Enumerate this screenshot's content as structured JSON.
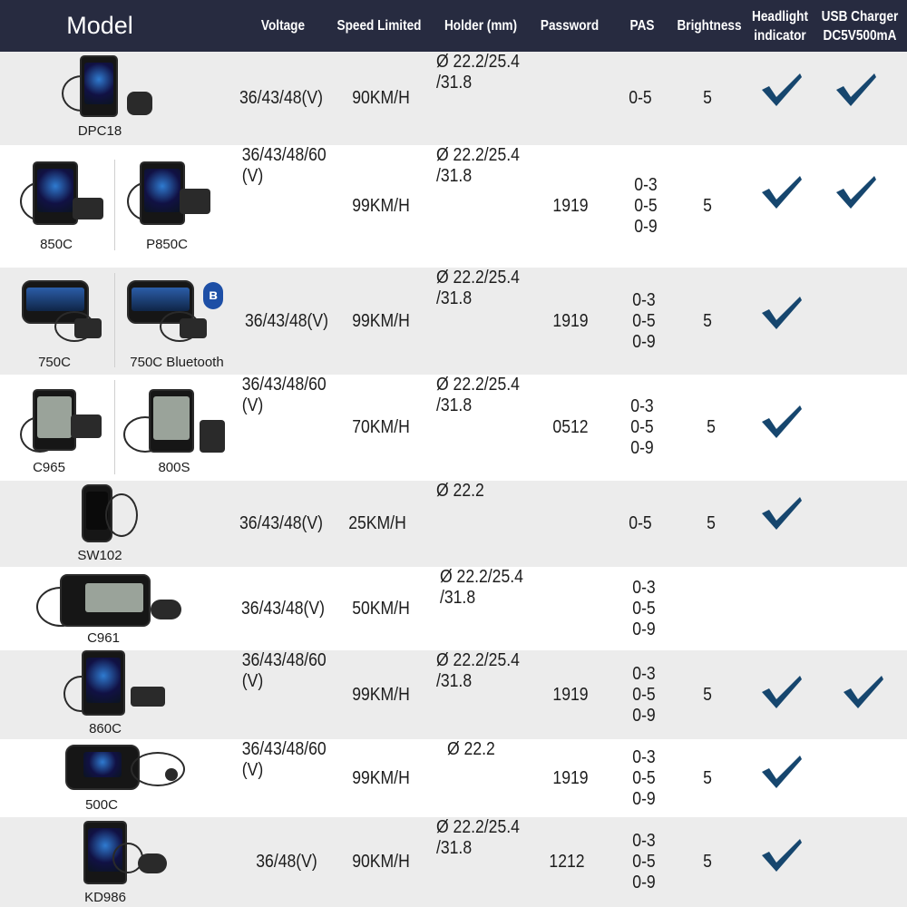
{
  "header": {
    "model": "Model",
    "voltage": "Voltage",
    "speed": "Speed Limited",
    "holder": "Holder (mm)",
    "password": "Password",
    "pas": "PAS",
    "brightness": "Brightness",
    "headlight_line1": "Headlight",
    "headlight_line2": "indicator",
    "usb_line1": "USB Charger",
    "usb_line2": "DC5V500mA"
  },
  "rows": [
    {
      "models": [
        "DPC18"
      ],
      "voltage": [
        "36/43/48(V)"
      ],
      "speed": "90KM/H",
      "holder": [
        "Ø 22.2/25.4",
        "/31.8"
      ],
      "password": "",
      "pas": [
        "0-5"
      ],
      "brightness": "5",
      "headlight": true,
      "usb": true
    },
    {
      "models": [
        "850C",
        "P850C"
      ],
      "voltage": [
        "36/43/48/60",
        "(V)"
      ],
      "speed": "99KM/H",
      "holder": [
        "Ø 22.2/25.4",
        "/31.8"
      ],
      "password": "1919",
      "pas": [
        "0-3",
        "0-5",
        "0-9"
      ],
      "brightness": "5",
      "headlight": true,
      "usb": true
    },
    {
      "models": [
        "750C",
        "750C Bluetooth"
      ],
      "voltage": [
        "36/43/48(V)"
      ],
      "speed": "99KM/H",
      "holder": [
        "Ø 22.2/25.4",
        "/31.8"
      ],
      "password": "1919",
      "pas": [
        "0-3",
        "0-5",
        "0-9"
      ],
      "brightness": "5",
      "headlight": true,
      "usb": false
    },
    {
      "models": [
        "C965",
        "800S"
      ],
      "voltage": [
        "36/43/48/60",
        "(V)"
      ],
      "speed": "70KM/H",
      "holder": [
        "Ø 22.2/25.4",
        "/31.8"
      ],
      "password": "0512",
      "pas": [
        "0-3",
        "0-5",
        "0-9"
      ],
      "brightness": "5",
      "headlight": true,
      "usb": false
    },
    {
      "models": [
        "SW102"
      ],
      "voltage": [
        "36/43/48(V)"
      ],
      "speed": "25KM/H",
      "holder": [
        "Ø 22.2"
      ],
      "password": "",
      "pas": [
        "0-5"
      ],
      "brightness": "5",
      "headlight": true,
      "usb": false
    },
    {
      "models": [
        "C961"
      ],
      "voltage": [
        "36/43/48(V)"
      ],
      "speed": "50KM/H",
      "holder": [
        "Ø 22.2/25.4",
        "/31.8"
      ],
      "password": "",
      "pas": [
        "0-3",
        "0-5",
        "0-9"
      ],
      "brightness": "",
      "headlight": false,
      "usb": false
    },
    {
      "models": [
        "860C"
      ],
      "voltage": [
        "36/43/48/60",
        "(V)"
      ],
      "speed": "99KM/H",
      "holder": [
        "Ø 22.2/25.4",
        "/31.8"
      ],
      "password": "1919",
      "pas": [
        "0-3",
        "0-5",
        "0-9"
      ],
      "brightness": "5",
      "headlight": true,
      "usb": true
    },
    {
      "models": [
        "500C"
      ],
      "voltage": [
        "36/43/48/60",
        "(V)"
      ],
      "speed": "99KM/H",
      "holder": [
        "Ø 22.2"
      ],
      "password": "1919",
      "pas": [
        "0-3",
        "0-5",
        "0-9"
      ],
      "brightness": "5",
      "headlight": true,
      "usb": false
    },
    {
      "models": [
        "KD986"
      ],
      "voltage": [
        "36/48(V)"
      ],
      "speed": "90KM/H",
      "holder": [
        "Ø 22.2/25.4",
        "/31.8"
      ],
      "password": "1212",
      "pas": [
        "0-3",
        "0-5",
        "0-9"
      ],
      "brightness": "5",
      "headlight": true,
      "usb": false
    }
  ],
  "bluetooth_badge": "ʙ",
  "colors": {
    "header_bg": "#272b40",
    "row_gray": "#ececec",
    "check": "#16466e",
    "bluetooth": "#1d4fa6"
  },
  "icons": {
    "check": "checkmark-icon",
    "bluetooth": "bluetooth-icon"
  }
}
